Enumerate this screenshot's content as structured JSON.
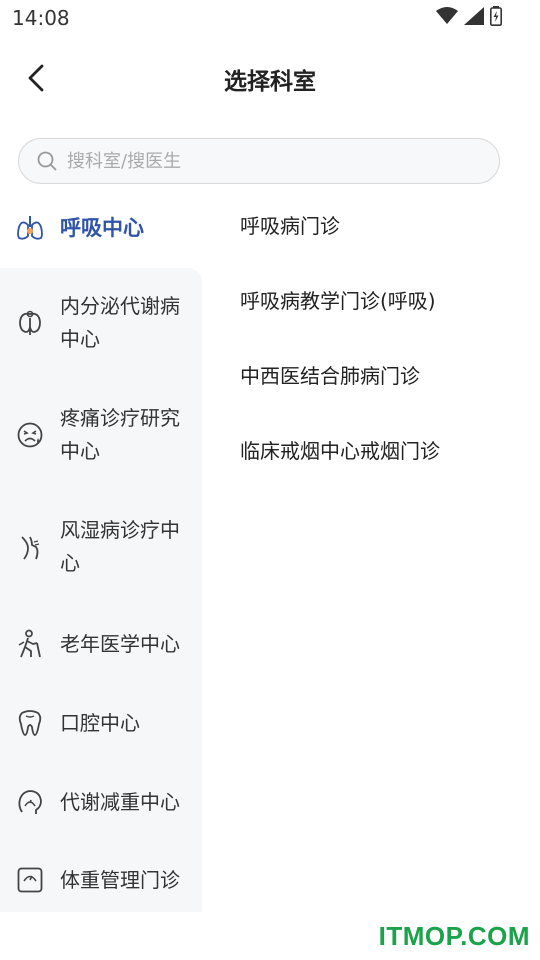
{
  "status_bar": {
    "time": "14:08"
  },
  "header": {
    "title": "选择科室"
  },
  "search": {
    "placeholder": "搜科室/搜医生"
  },
  "sidebar": {
    "items": [
      {
        "label": "呼吸中心",
        "icon": "lungs-icon",
        "active": true
      },
      {
        "label": "内分泌代谢病中心",
        "icon": "thyroid-icon",
        "active": false
      },
      {
        "label": "疼痛诊疗研究中心",
        "icon": "pain-face-icon",
        "active": false
      },
      {
        "label": "风湿病诊疗中心",
        "icon": "joint-icon",
        "active": false
      },
      {
        "label": "老年医学中心",
        "icon": "elderly-icon",
        "active": false
      },
      {
        "label": "口腔中心",
        "icon": "tooth-icon",
        "active": false
      },
      {
        "label": "代谢减重中心",
        "icon": "weight-head-icon",
        "active": false
      },
      {
        "label": "体重管理门诊",
        "icon": "scale-icon",
        "active": false
      }
    ]
  },
  "departments": [
    {
      "label": "呼吸病门诊"
    },
    {
      "label": "呼吸病教学门诊(呼吸)"
    },
    {
      "label": "中西医结合肺病门诊"
    },
    {
      "label": "临床戒烟中心戒烟门诊"
    }
  ],
  "watermark": {
    "text": "ITMOP.COM"
  },
  "colors": {
    "accent": "#2f54a8",
    "sidebar_bg": "#f6f7f9",
    "watermark": "#1aa34a"
  }
}
